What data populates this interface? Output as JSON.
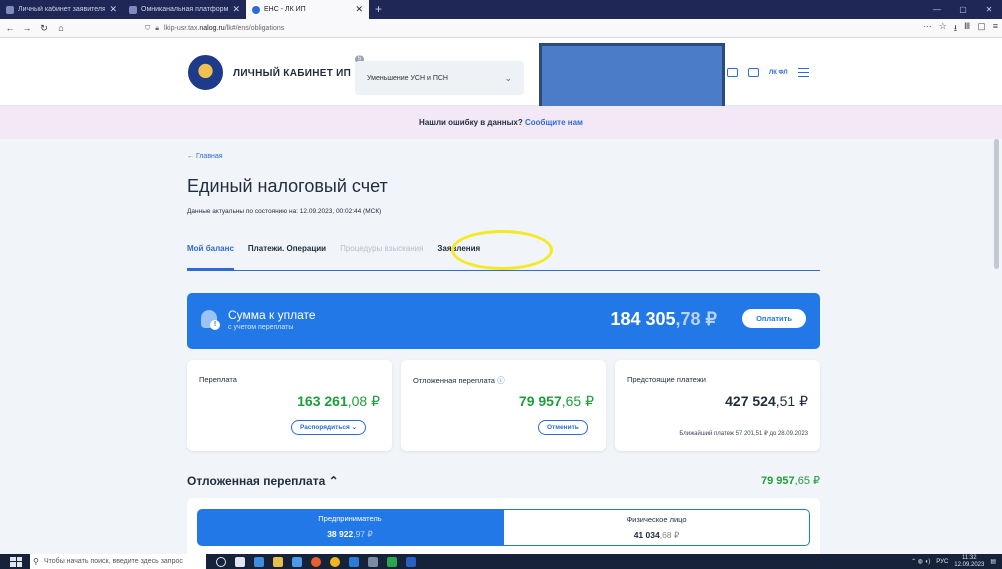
{
  "browser": {
    "tabs": [
      {
        "title": "Личный кабинет заявителя",
        "active": false
      },
      {
        "title": "Омниканальная платформа",
        "active": false
      },
      {
        "title": "ЕНС - ЛК ИП",
        "active": true
      }
    ],
    "new_tab": "+",
    "url_prefix": "lkip-usr.tax.",
    "url_host": "nalog.ru",
    "url_path": "/lk#/ens/obligations",
    "win_controls": [
      "—",
      "▢",
      "✕"
    ]
  },
  "header": {
    "title": "ЛИЧНЫЙ КАБИНЕТ ИП",
    "badge": "5",
    "mode_select": "Уменьшение УСН и ПСН",
    "lk_label": "ЛК ФЛ"
  },
  "notice": {
    "text": "Нашли ошибку в данных? ",
    "link": "Сообщите нам"
  },
  "page": {
    "back": "← Главная",
    "title": "Единый налоговый счет",
    "as_of": "Данные актуальны по состоянию на: 12.09.2023, 00:02:44 (МСК)"
  },
  "tabs": [
    {
      "label": "Мой баланс",
      "state": "active"
    },
    {
      "label": "Платежи. Операции",
      "state": "normal"
    },
    {
      "label": "Процедуры взыскания",
      "state": "disabled"
    },
    {
      "label": "Заявления",
      "state": "normal"
    }
  ],
  "payment": {
    "label": "Сумма к уплате",
    "sub": "с учетом переплаты",
    "amount_int": "184 305",
    "amount_frac": ",78 ₽",
    "button": "Оплатить"
  },
  "cards": {
    "overpay": {
      "label": "Переплата",
      "int": "163 261",
      "frac": ",08 ₽",
      "button": "Распорядиться"
    },
    "deferred": {
      "label": "Отложенная переплата",
      "int": "79 957",
      "frac": ",65 ₽",
      "button": "Отменить"
    },
    "upcoming": {
      "label": "Предстоящие платежи",
      "int": "427 524",
      "frac": ",51 ₽",
      "next": "Ближайший платеж 57 201,51 ₽ до 28.09.2023"
    }
  },
  "deferred_section": {
    "title": "Отложенная переплата",
    "amount_int": "79 957",
    "amount_frac": ",65 ₽",
    "left": {
      "name": "Предприниматель",
      "int": "38 922",
      "frac": ",97 ₽"
    },
    "right": {
      "name": "Физическое лицо",
      "int": "41 034",
      "frac": ",68 ₽"
    }
  },
  "taskbar": {
    "search_placeholder": "Чтобы начать поиск, введите здесь запрос",
    "lang": "РУС",
    "time": "11:32",
    "date": "12.09.2023"
  },
  "colors": {
    "accent": "#2378e8",
    "green": "#1e9e3a",
    "highlight": "#f4ea21",
    "notice_bg": "#f3e9f6"
  }
}
